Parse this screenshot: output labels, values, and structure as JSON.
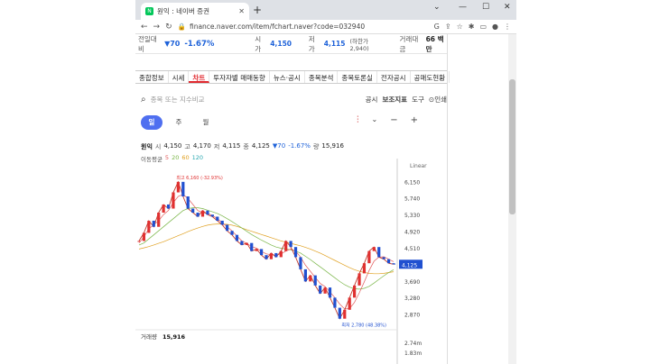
{
  "browser": {
    "tab_title": "원익 : 네이버 증권",
    "url": "finance.naver.com/item/fchart.naver?code=032940"
  },
  "stock": {
    "prev_label": "전일대비",
    "change": "▼70",
    "change_pct": "-1.67%",
    "open_label": "시가",
    "open": "4,150",
    "low_label": "저가",
    "low": "4,115",
    "low_limit": "(하한가 2,940)",
    "amount_label": "거래대금",
    "amount": "66 백만"
  },
  "menu": [
    "종합정보",
    "시세",
    "차트",
    "투자자별 매매동향",
    "뉴스·공시",
    "종목분석",
    "종목토론실",
    "전자공시",
    "공매도현황"
  ],
  "search": {
    "placeholder": "종목 또는 지수비교",
    "tools": [
      "공시",
      "보조지표",
      "도구"
    ],
    "print": "인쇄"
  },
  "periods": [
    "일",
    "주",
    "월"
  ],
  "info": {
    "name": "원익",
    "open_l": "시",
    "open": "4,150",
    "high_l": "고",
    "high": "4,170",
    "low_l": "저",
    "low": "4,115",
    "close_l": "종",
    "close": "4,125",
    "chg": "▼70",
    "chg_pct": "-1.67%",
    "vol_l": "량",
    "vol": "15,916"
  },
  "ma": {
    "label": "이동평균",
    "periods": [
      "5",
      "20",
      "60",
      "120"
    ]
  },
  "chart_labels": {
    "scale": "Linear",
    "max_label": "최고 6,160 (-32.93%)",
    "min_label": "최저 2,780 (48.38%)",
    "volume_label": "거래량",
    "volume": "15,916",
    "vol_axis": [
      "2.74m",
      "1.83m"
    ]
  },
  "chart_data": {
    "type": "line",
    "yticks": [
      6150,
      5740,
      5330,
      4920,
      4510,
      4125,
      3690,
      3280,
      2870
    ],
    "current": 4125,
    "high": 6160,
    "low": 2780,
    "ylim": [
      2640,
      6290
    ],
    "series": [
      {
        "name": "종가",
        "values": [
          4700,
          4900,
          5200,
          5050,
          5400,
          5600,
          5500,
          5900,
          6160,
          5800,
          5500,
          5400,
          5300,
          5450,
          5350,
          5300,
          5200,
          5100,
          4950,
          4850,
          4700,
          4600,
          4650,
          4450,
          4500,
          4350,
          4250,
          4400,
          4300,
          4450,
          4700,
          4550,
          4300,
          4000,
          3700,
          3850,
          3600,
          3400,
          3550,
          3300,
          3050,
          2780,
          3000,
          3300,
          3600,
          3900,
          4150,
          4450,
          4550,
          4300,
          4250,
          4150,
          4125
        ]
      },
      {
        "name": "5",
        "values": [
          4650,
          4800,
          5000,
          5100,
          5200,
          5350,
          5450,
          5650,
          5800,
          5850,
          5750,
          5600,
          5450,
          5400,
          5380,
          5330,
          5250,
          5150,
          5050,
          4950,
          4820,
          4700,
          4640,
          4560,
          4520,
          4440,
          4380,
          4360,
          4350,
          4380,
          4450,
          4500,
          4450,
          4300,
          4100,
          3950,
          3800,
          3650,
          3570,
          3440,
          3300,
          3140,
          3020,
          3030,
          3180,
          3420,
          3690,
          3970,
          4200,
          4300,
          4310,
          4250,
          4190
        ]
      },
      {
        "name": "20",
        "values": [
          4600,
          4650,
          4750,
          4850,
          4950,
          5050,
          5150,
          5250,
          5350,
          5450,
          5500,
          5520,
          5520,
          5500,
          5460,
          5420,
          5380,
          5320,
          5250,
          5180,
          5100,
          5020,
          4940,
          4860,
          4790,
          4720,
          4660,
          4600,
          4550,
          4520,
          4500,
          4480,
          4450,
          4400,
          4320,
          4240,
          4150,
          4060,
          3970,
          3880,
          3790,
          3700,
          3620,
          3560,
          3520,
          3510,
          3530,
          3580,
          3660,
          3750,
          3840,
          3920,
          3990
        ]
      },
      {
        "name": "60",
        "values": [
          4500,
          4530,
          4560,
          4600,
          4640,
          4680,
          4730,
          4780,
          4830,
          4880,
          4930,
          4980,
          5020,
          5060,
          5090,
          5110,
          5120,
          5120,
          5110,
          5090,
          5060,
          5020,
          4980,
          4940,
          4900,
          4860,
          4820,
          4780,
          4740,
          4700,
          4670,
          4640,
          4610,
          4580,
          4540,
          4500,
          4450,
          4400,
          4340,
          4280,
          4220,
          4160,
          4100,
          4040,
          3990,
          3950,
          3920,
          3900,
          3890,
          3890,
          3900,
          3920,
          3940
        ]
      }
    ]
  }
}
